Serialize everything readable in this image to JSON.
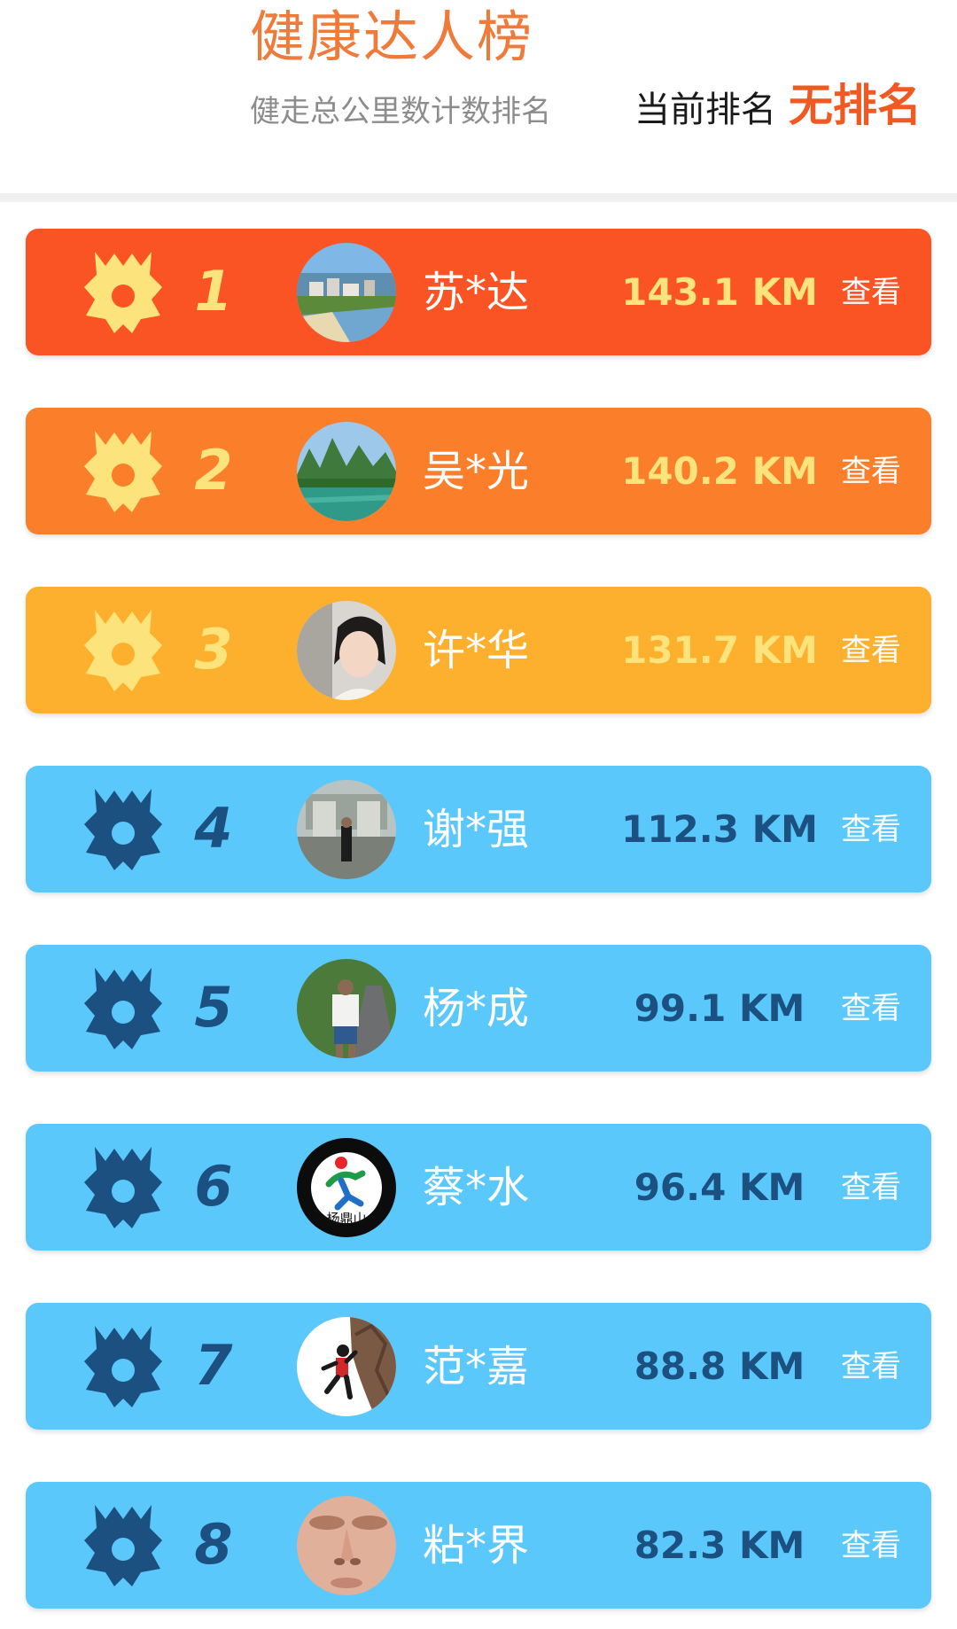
{
  "header": {
    "title": "健康达人榜",
    "subtitle": "健走总公里数计数排名",
    "current_rank_label": "当前排名",
    "current_rank_value": "无排名"
  },
  "colors": {
    "rank1_bg": "#fb5424",
    "rank2_bg": "#fb7e2b",
    "rank3_bg": "#fdb02d",
    "other_bg": "#5ac8fb",
    "gold_text": "#fde37c",
    "navy_text": "#1b5080"
  },
  "leaderboard": [
    {
      "rank": "1",
      "name": "苏*达",
      "distance": "143.1 KM",
      "action": "查看",
      "medal": "gold-medal-icon",
      "avatar": "river-town-landscape"
    },
    {
      "rank": "2",
      "name": "吴*光",
      "distance": "140.2 KM",
      "action": "查看",
      "medal": "gold-medal-icon",
      "avatar": "karst-mountain-lake"
    },
    {
      "rank": "3",
      "name": "许*华",
      "distance": "131.7 KM",
      "action": "查看",
      "medal": "gold-medal-icon",
      "avatar": "woman-portrait"
    },
    {
      "rank": "4",
      "name": "谢*强",
      "distance": "112.3 KM",
      "action": "查看",
      "medal": "navy-medal-icon",
      "avatar": "man-at-gate"
    },
    {
      "rank": "5",
      "name": "杨*成",
      "distance": "99.1 KM",
      "action": "查看",
      "medal": "navy-medal-icon",
      "avatar": "man-on-path"
    },
    {
      "rank": "6",
      "name": "蔡*水",
      "distance": "96.4 KM",
      "action": "查看",
      "medal": "navy-medal-icon",
      "avatar": "runner-logo",
      "avatar_text": "杨鼎山"
    },
    {
      "rank": "7",
      "name": "范*嘉",
      "distance": "88.8 KM",
      "action": "查看",
      "medal": "navy-medal-icon",
      "avatar": "rock-climber"
    },
    {
      "rank": "8",
      "name": "粘*界",
      "distance": "82.3 KM",
      "action": "查看",
      "medal": "navy-medal-icon",
      "avatar": "face-closeup"
    }
  ]
}
